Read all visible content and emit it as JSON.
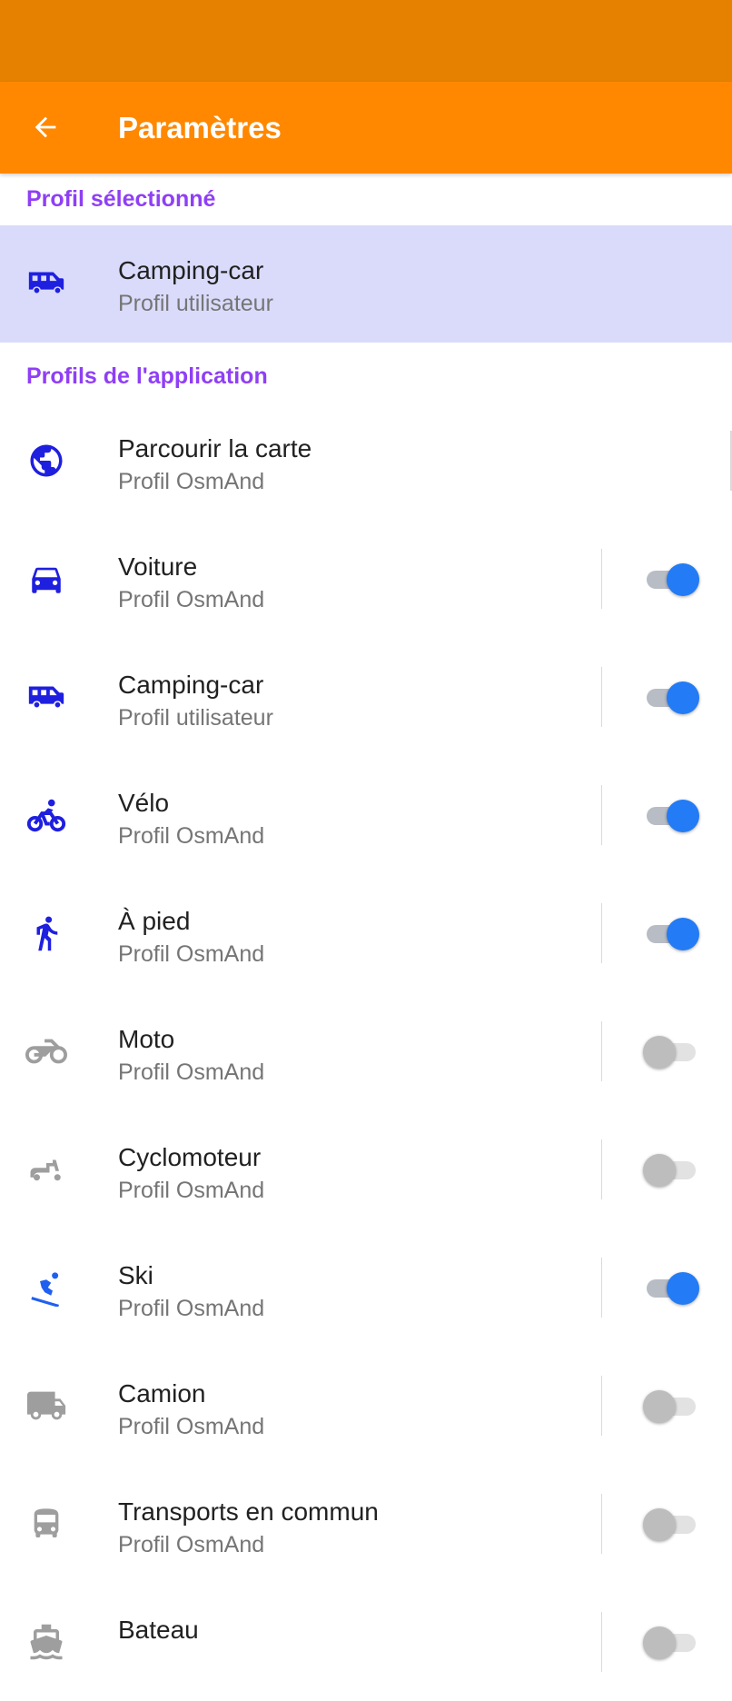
{
  "app_bar": {
    "title": "Paramètres",
    "back_icon": "arrow-left-icon"
  },
  "colors": {
    "status_bar": "#E68100",
    "app_bar": "#FF8800",
    "section_header": "#8F3FF5",
    "selected_bg": "#DADBFB",
    "active_icon": "#1F1FE0",
    "inactive_icon": "#9E9E9E",
    "switch_on": "#237BF5"
  },
  "selected_section": {
    "header": "Profil sélectionné",
    "profile": {
      "title": "Camping-car",
      "subtitle": "Profil utilisateur",
      "icon": "motorhome-icon"
    }
  },
  "app_section": {
    "header": "Profils de l'application",
    "profiles": [
      {
        "title": "Parcourir la carte",
        "subtitle": "Profil OsmAnd",
        "icon": "globe-icon",
        "enabled": true
      },
      {
        "title": "Voiture",
        "subtitle": "Profil OsmAnd",
        "icon": "car-icon",
        "enabled": true
      },
      {
        "title": "Camping-car",
        "subtitle": "Profil utilisateur",
        "icon": "motorhome-icon",
        "enabled": true
      },
      {
        "title": "Vélo",
        "subtitle": "Profil OsmAnd",
        "icon": "bicycle-icon",
        "enabled": true
      },
      {
        "title": "À pied",
        "subtitle": "Profil OsmAnd",
        "icon": "pedestrian-icon",
        "enabled": true
      },
      {
        "title": "Moto",
        "subtitle": "Profil OsmAnd",
        "icon": "motorcycle-icon",
        "enabled": false
      },
      {
        "title": "Cyclomoteur",
        "subtitle": "Profil OsmAnd",
        "icon": "scooter-icon",
        "enabled": false
      },
      {
        "title": "Ski",
        "subtitle": "Profil OsmAnd",
        "icon": "ski-icon",
        "enabled": true
      },
      {
        "title": "Camion",
        "subtitle": "Profil OsmAnd",
        "icon": "truck-icon",
        "enabled": false
      },
      {
        "title": "Transports en commun",
        "subtitle": "Profil OsmAnd",
        "icon": "bus-icon",
        "enabled": false
      },
      {
        "title": "Bateau",
        "subtitle": "",
        "icon": "boat-icon",
        "enabled": false
      }
    ]
  }
}
